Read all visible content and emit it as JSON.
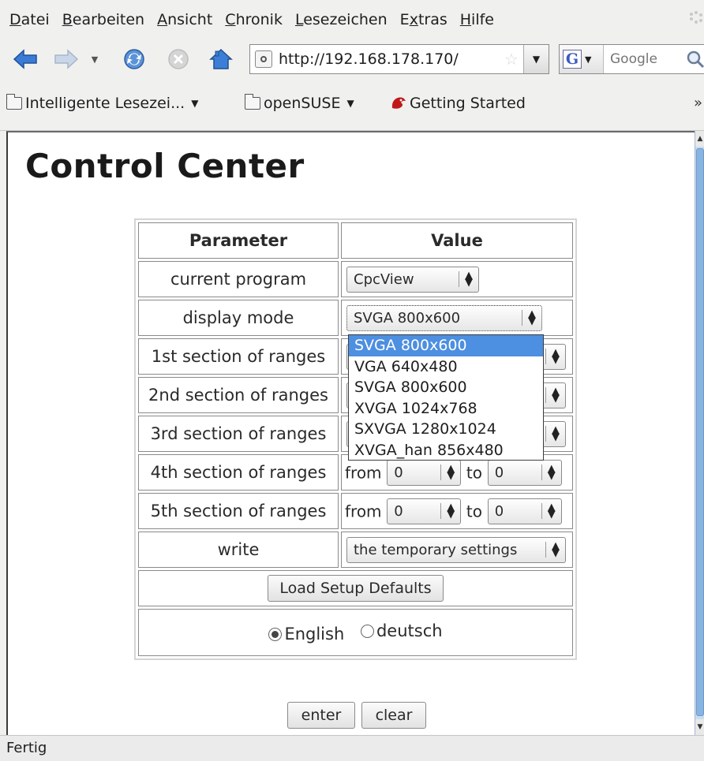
{
  "menubar": {
    "items": [
      {
        "pre": "",
        "key": "D",
        "post": "atei"
      },
      {
        "pre": "",
        "key": "B",
        "post": "earbeiten"
      },
      {
        "pre": "",
        "key": "A",
        "post": "nsicht"
      },
      {
        "pre": "",
        "key": "C",
        "post": "hronik"
      },
      {
        "pre": "",
        "key": "L",
        "post": "esezeichen"
      },
      {
        "pre": "E",
        "key": "x",
        "post": "tras"
      },
      {
        "pre": "",
        "key": "H",
        "post": "ilfe"
      }
    ]
  },
  "navbar": {
    "url": "http://192.168.178.170/",
    "search_engine_letter": "G",
    "search_placeholder": "Google"
  },
  "bookmarks": {
    "items": [
      {
        "label": "Intelligente Lesezei...",
        "icon": "folder-icon",
        "has_menu": true
      },
      {
        "label": "openSUSE",
        "icon": "folder-icon",
        "has_menu": true
      },
      {
        "label": "Getting Started",
        "icon": "getting-started-icon",
        "has_menu": false
      }
    ],
    "overflow": "»"
  },
  "page": {
    "title": "Control Center",
    "table": {
      "header_parameter": "Parameter",
      "header_value": "Value",
      "current_program": {
        "label": "current program",
        "value": "CpcView"
      },
      "display_mode": {
        "label": "display mode",
        "value": "SVGA 800x600"
      },
      "sections": [
        {
          "label": "1st section of ranges"
        },
        {
          "label": "2nd section of ranges"
        },
        {
          "label": "3rd section of ranges"
        },
        {
          "label": "4th section of ranges",
          "from_label": "from",
          "from_value": "0",
          "to_label": "to",
          "to_value": "0"
        },
        {
          "label": "5th section of ranges",
          "from_label": "from",
          "from_value": "0",
          "to_label": "to",
          "to_value": "0"
        }
      ],
      "write": {
        "label": "write",
        "value": "the temporary settings"
      },
      "load_defaults_label": "Load Setup Defaults",
      "language": {
        "english_label": "English",
        "deutsch_label": "deutsch",
        "selected": "English"
      }
    },
    "display_mode_options": [
      "SVGA 800x600",
      "VGA 640x480",
      "SVGA 800x600",
      "XVGA 1024x768",
      "SXVGA 1280x1024",
      "XVGA_han 856x480"
    ],
    "display_mode_highlighted_index": 0,
    "enter_label": "enter",
    "clear_label": "clear"
  },
  "status": {
    "text": "Fertig"
  },
  "colors": {
    "selection": "#4d8fe0",
    "scrollbar": "#88b4e2"
  }
}
